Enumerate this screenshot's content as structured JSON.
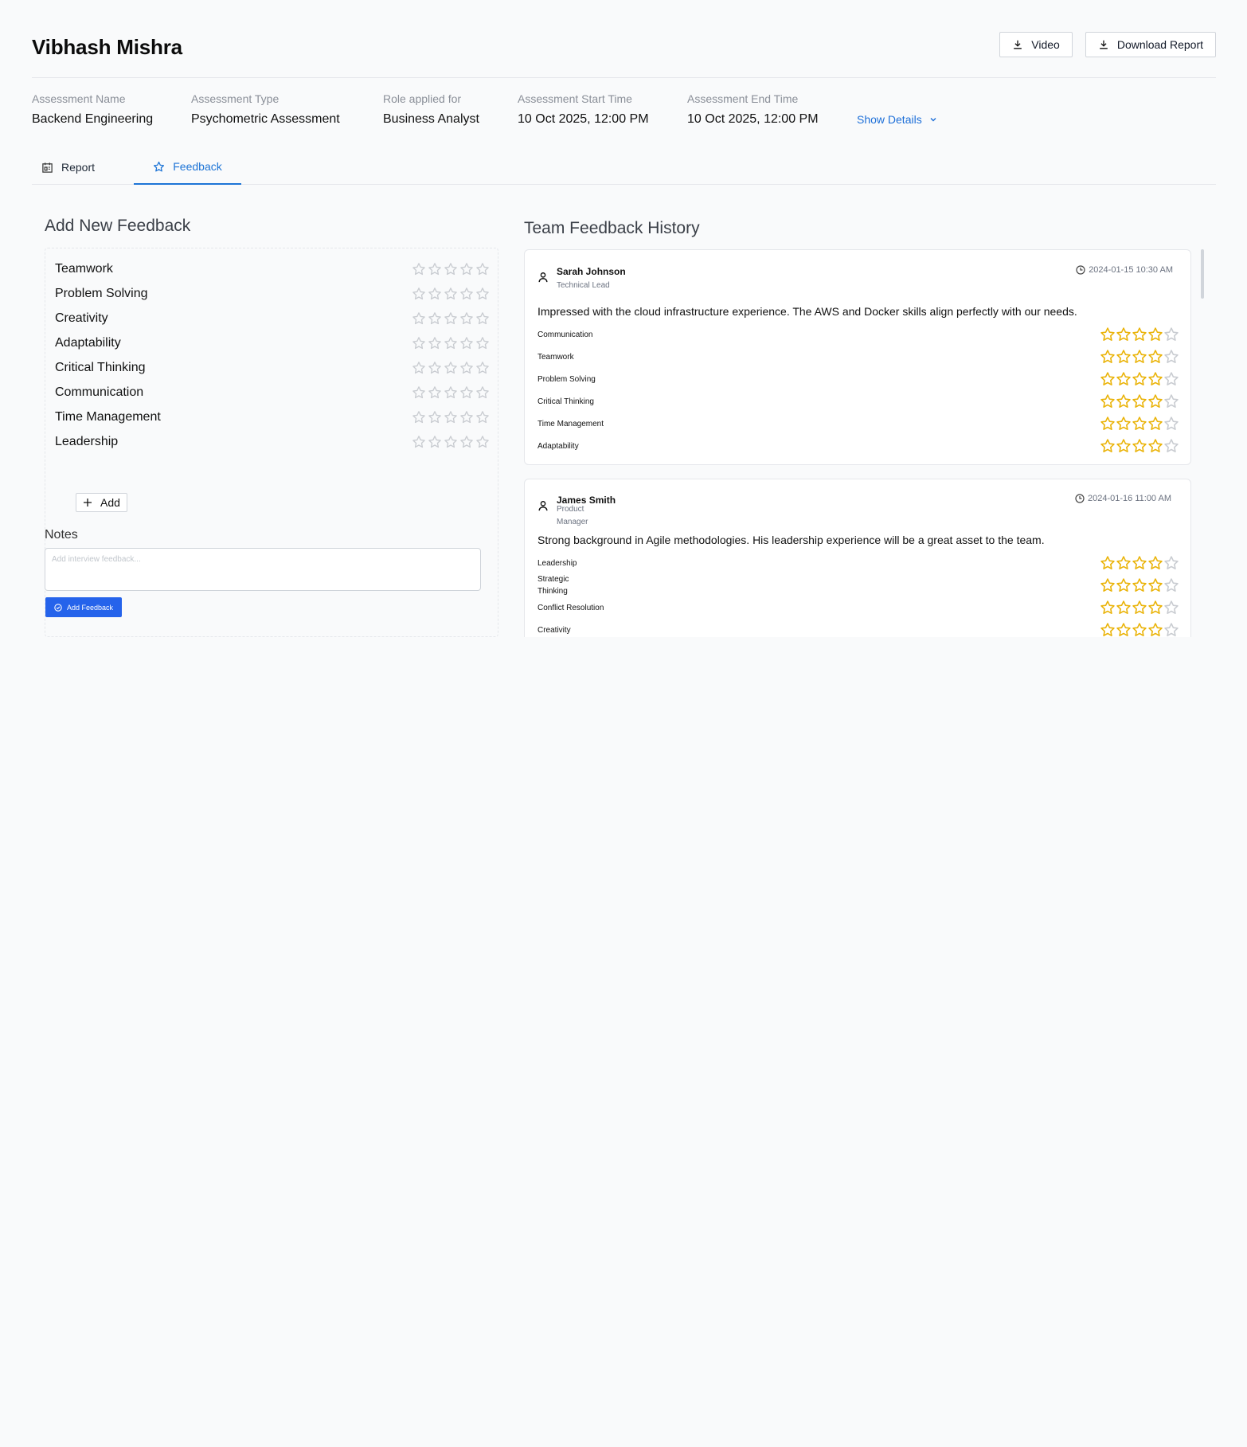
{
  "candidate": {
    "name": "Vibhash Mishra"
  },
  "actions": {
    "video_label": "Video",
    "download_label": "Download Report"
  },
  "meta": {
    "assessment_name": {
      "label": "Assessment Name",
      "value": "Backend Engineering"
    },
    "assessment_type": {
      "label": "Assessment Type",
      "value": "Psychometric Assessment"
    },
    "role": {
      "label": "Role applied for",
      "value": "Business Analyst"
    },
    "start_time": {
      "label": "Assessment Start Time",
      "value": "10 Oct 2025, 12:00 PM"
    },
    "end_time": {
      "label": "Assessment End Time",
      "value": "10 Oct 2025, 12:00 PM"
    },
    "show_details": "Show Details"
  },
  "tabs": [
    {
      "label": "Report",
      "active": false
    },
    {
      "label": "Feedback",
      "active": true
    }
  ],
  "add_feedback": {
    "title": "Add New Feedback",
    "criteria": [
      {
        "label": "Teamwork",
        "rating": 0
      },
      {
        "label": "Problem Solving",
        "rating": 0
      },
      {
        "label": "Creativity",
        "rating": 0
      },
      {
        "label": "Adaptability",
        "rating": 0
      },
      {
        "label": "Critical Thinking",
        "rating": 0
      },
      {
        "label": "Communication",
        "rating": 0
      },
      {
        "label": "Time Management",
        "rating": 0
      },
      {
        "label": "Leadership",
        "rating": 0
      }
    ],
    "max_rating": 5,
    "add_label": "Add",
    "notes_label": "Notes",
    "notes_placeholder": "Add interview feedback...",
    "submit_label": "Add Feedback"
  },
  "history": {
    "title": "Team Feedback History",
    "entries": [
      {
        "name": "Sarah Johnson",
        "role": "Technical Lead",
        "timestamp": "2024-01-15 10:30 AM",
        "comment": "Impressed with the cloud infrastructure experience. The AWS and Docker skills align perfectly with our needs.",
        "ratings": [
          {
            "label": "Communication",
            "rating": 4
          },
          {
            "label": "Teamwork",
            "rating": 4
          },
          {
            "label": "Problem Solving",
            "rating": 4
          },
          {
            "label": "Critical Thinking",
            "rating": 4
          },
          {
            "label": "Time Management",
            "rating": 4
          },
          {
            "label": "Adaptability",
            "rating": 4
          }
        ]
      },
      {
        "name": "James Smith",
        "role": "Product Manager",
        "timestamp": "2024-01-16 11:00 AM",
        "comment": "Strong background in Agile methodologies. His leadership experience will be a great asset to the team.",
        "ratings": [
          {
            "label": "Leadership",
            "rating": 4
          },
          {
            "label": "Strategic Thinking",
            "rating": 4
          },
          {
            "label": "Conflict Resolution",
            "rating": 4
          },
          {
            "label": "Creativity",
            "rating": 4
          }
        ]
      }
    ]
  },
  "colors": {
    "accent": "#2563eb",
    "tab_active": "#1d74d6",
    "star_filled": "#eab308",
    "star_empty": "#c9ccd1"
  }
}
